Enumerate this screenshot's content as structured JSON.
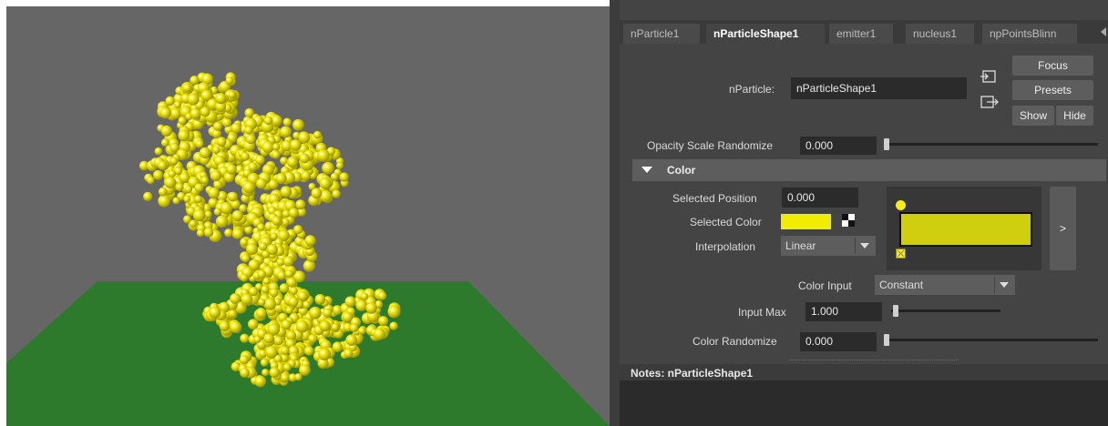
{
  "viewport": {
    "background": "#666666",
    "ground_color": "#2d7a2d",
    "particle_color": "#e6e000"
  },
  "attribute_editor": {
    "tabs": [
      {
        "label": "nParticle1",
        "active": false
      },
      {
        "label": "nParticleShape1",
        "active": true
      },
      {
        "label": "emitter1",
        "active": false
      },
      {
        "label": "nucleus1",
        "active": false
      },
      {
        "label": "npPointsBlinn",
        "active": false
      }
    ],
    "node": {
      "label": "nParticle:",
      "value": "nParticleShape1"
    },
    "buttons": {
      "focus": "Focus",
      "presets": "Presets",
      "show": "Show",
      "hide": "Hide"
    },
    "opacity_scale_randomize": {
      "label": "Opacity Scale Randomize",
      "value": "0.000"
    },
    "color_section": {
      "title": "Color",
      "selected_position": {
        "label": "Selected Position",
        "value": "0.000"
      },
      "selected_color": {
        "label": "Selected Color",
        "swatch": "#f2ec00"
      },
      "interpolation": {
        "label": "Interpolation",
        "value": "Linear"
      },
      "ramp_color": "#cfcf10",
      "expand_button": ">",
      "color_input": {
        "label": "Color Input",
        "value": "Constant"
      },
      "input_max": {
        "label": "Input Max",
        "value": "1.000"
      },
      "color_randomize": {
        "label": "Color Randomize",
        "value": "0.000"
      }
    },
    "notes": {
      "label": "Notes:  nParticleShape1"
    }
  }
}
